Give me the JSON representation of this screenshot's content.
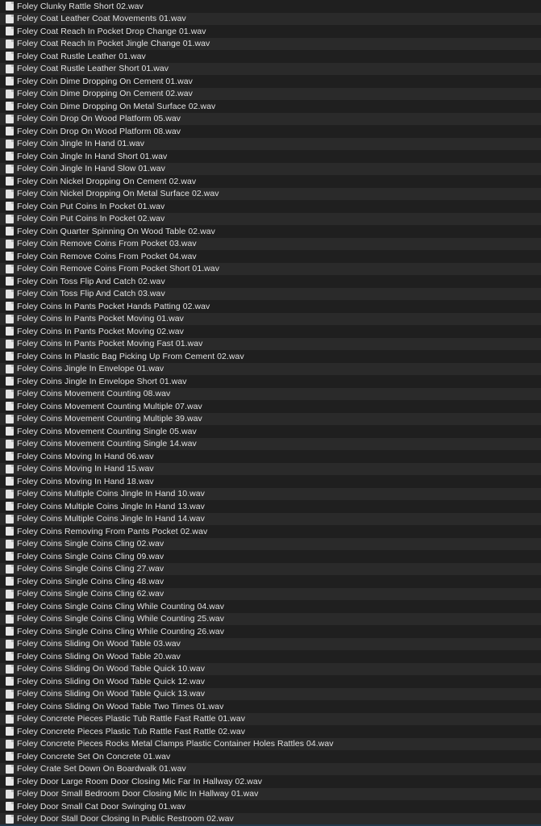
{
  "files": [
    "Foley Clunky Rattle Short 02.wav",
    "Foley Coat Leather Coat Movements 01.wav",
    "Foley Coat Reach In Pocket Drop Change 01.wav",
    "Foley Coat Reach In Pocket Jingle Change 01.wav",
    "Foley Coat Rustle Leather 01.wav",
    "Foley Coat Rustle Leather Short 01.wav",
    "Foley Coin Dime Dropping On Cement 01.wav",
    "Foley Coin Dime Dropping On Cement 02.wav",
    "Foley Coin Dime Dropping On Metal Surface 02.wav",
    "Foley Coin Drop On Wood Platform 05.wav",
    "Foley Coin Drop On Wood Platform 08.wav",
    "Foley Coin Jingle In Hand 01.wav",
    "Foley Coin Jingle In Hand Short 01.wav",
    "Foley Coin Jingle In Hand Slow 01.wav",
    "Foley Coin Nickel Dropping On Cement 02.wav",
    "Foley Coin Nickel Dropping On Metal Surface 02.wav",
    "Foley Coin Put Coins In Pocket 01.wav",
    "Foley Coin Put Coins In Pocket 02.wav",
    "Foley Coin Quarter Spinning On Wood Table 02.wav",
    "Foley Coin Remove Coins From Pocket 03.wav",
    "Foley Coin Remove Coins From Pocket 04.wav",
    "Foley Coin Remove Coins From Pocket Short 01.wav",
    "Foley Coin Toss Flip And Catch 02.wav",
    "Foley Coin Toss Flip And Catch 03.wav",
    "Foley Coins In Pants Pocket Hands Patting 02.wav",
    "Foley Coins In Pants Pocket Moving 01.wav",
    "Foley Coins In Pants Pocket Moving 02.wav",
    "Foley Coins In Pants Pocket Moving Fast 01.wav",
    "Foley Coins In Plastic Bag Picking Up From Cement 02.wav",
    "Foley Coins Jingle In Envelope 01.wav",
    "Foley Coins Jingle In Envelope Short 01.wav",
    "Foley Coins Movement Counting 08.wav",
    "Foley Coins Movement Counting Multiple 07.wav",
    "Foley Coins Movement Counting Multiple 39.wav",
    "Foley Coins Movement Counting Single 05.wav",
    "Foley Coins Movement Counting Single 14.wav",
    "Foley Coins Moving In Hand 06.wav",
    "Foley Coins Moving In Hand 15.wav",
    "Foley Coins Moving In Hand 18.wav",
    "Foley Coins Multiple Coins Jingle In Hand 10.wav",
    "Foley Coins Multiple Coins Jingle In Hand 13.wav",
    "Foley Coins Multiple Coins Jingle In Hand 14.wav",
    "Foley Coins Removing From Pants Pocket 02.wav",
    "Foley Coins Single Coins Cling 02.wav",
    "Foley Coins Single Coins Cling 09.wav",
    "Foley Coins Single Coins Cling 27.wav",
    "Foley Coins Single Coins Cling 48.wav",
    "Foley Coins Single Coins Cling 62.wav",
    "Foley Coins Single Coins Cling While Counting 04.wav",
    "Foley Coins Single Coins Cling While Counting 25.wav",
    "Foley Coins Single Coins Cling While Counting 26.wav",
    "Foley Coins Sliding On Wood Table 03.wav",
    "Foley Coins Sliding On Wood Table 20.wav",
    "Foley Coins Sliding On Wood Table Quick 10.wav",
    "Foley Coins Sliding On Wood Table Quick 12.wav",
    "Foley Coins Sliding On Wood Table Quick 13.wav",
    "Foley Coins Sliding On Wood Table Two Times 01.wav",
    "Foley Concrete Pieces Plastic Tub Rattle Fast Rattle 01.wav",
    "Foley Concrete Pieces Plastic Tub Rattle Fast Rattle 02.wav",
    "Foley Concrete Pieces Rocks Metal Clamps Plastic Container Holes Rattles 04.wav",
    "Foley Concrete Set On Concrete 01.wav",
    "Foley Crate Set Down On Boardwalk 01.wav",
    "Foley Door Large Room Door Closing Mic Far In Hallway 02.wav",
    "Foley Door Small Bedroom Door Closing Mic In Hallway 01.wav",
    "Foley Door Small Cat Door Swinging 01.wav",
    "Foley Door Stall Door Closing In Public Restroom 02.wav"
  ],
  "icon": "audio-file-icon"
}
